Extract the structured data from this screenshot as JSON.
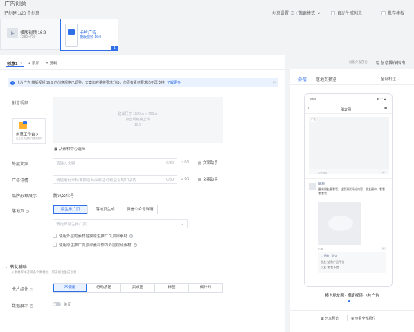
{
  "header": {
    "title": "广告创意",
    "count_text": "已创建 1/20 个创意",
    "creative_group_label": "创意设置",
    "preferred_mode": "优选模式",
    "auto_save_label": "自动生成创意",
    "save_template_label": "批存模板"
  },
  "creatives": [
    {
      "name": "横版视频 16:9",
      "size": "1280×720"
    },
    {
      "name": "卡片广告",
      "sub": "横版视频 16:9",
      "badge": "1"
    }
  ],
  "tabs_bar": {
    "tab_label": "创意1",
    "close_icon": "×",
    "add_label": "添加",
    "copy_label": "复制",
    "preview_link": "创意外观部分",
    "creative_ops_label": "创意操作指南"
  },
  "notice": {
    "text_pre": "卡片广告 横版视频 16:9 的创意规格已调整，文案和容量将要求升级，但原有素材要求均不再支持",
    "link": "了解更多",
    "close": "×"
  },
  "form": {
    "video_label": "创意视频",
    "upload_hint": "建议尺寸 1280px × 720px",
    "upload_hint2": "点击或拖拽上传",
    "upload_ratio": "16:9",
    "studio_title": "创意工作台 >",
    "studio_sub": "在此处快速制作视频素材",
    "library_label": "从素材中心选择",
    "brief_label": "外层文案",
    "brief_placeholder": "请输入文案",
    "brief_counter": "0/30",
    "brief_count2": "0/1",
    "copy_helper": "文案助手",
    "detail_label": "广告详情",
    "detail_placeholder": "请使用行业标准描述商品或活动利益点的10字内",
    "detail_counter": "0/30",
    "detail_count2": "0/1",
    "detail_helper": "文案助手",
    "brand_label": "品牌形象展示",
    "brand_value": "腾讯公众号",
    "landing_label": "落地页",
    "landing_tabs": [
      "原生推广页",
      "落地页生成",
      "微信公众号详情"
    ],
    "landing_placeholder": "请选择原生推广页",
    "check1": "使用外层的素材替换原生推广页顶部素材",
    "check2": "使用原生推广页顶部素材作为外层视频素材",
    "assist_title": "转化辅助",
    "assist_desc": "从素材库中选择多个素材组，用于组合生成创意",
    "card_label": "卡片组件",
    "card_options": [
      "不使用",
      "行动按钮",
      "卖点图",
      "标签",
      "倒计时"
    ],
    "data_label": "数据展示",
    "data_toggle": "关闭"
  },
  "preview": {
    "tabs": [
      "外层",
      "落地页预览"
    ],
    "dropdown": "全部机位",
    "status_time": "AM5",
    "nav_title": "朋友圈",
    "ad_label": "广告",
    "time_stamp": "1分钟前",
    "comment_name": "昵称",
    "comment_text": "圈来朋友圈看看，这是测试评论内容，朋友圈中，看看看看看",
    "location_tag": "位置",
    "like_line": "♡ 朋友、好友",
    "reply_line1": "朋友: 这款产品不错",
    "reply_line2": "小友: 看看不错",
    "caption": "横也朋友圈 · 横版视频-卡片广告",
    "btn_share": "分享预览",
    "btn_view": "查看全部机位"
  }
}
